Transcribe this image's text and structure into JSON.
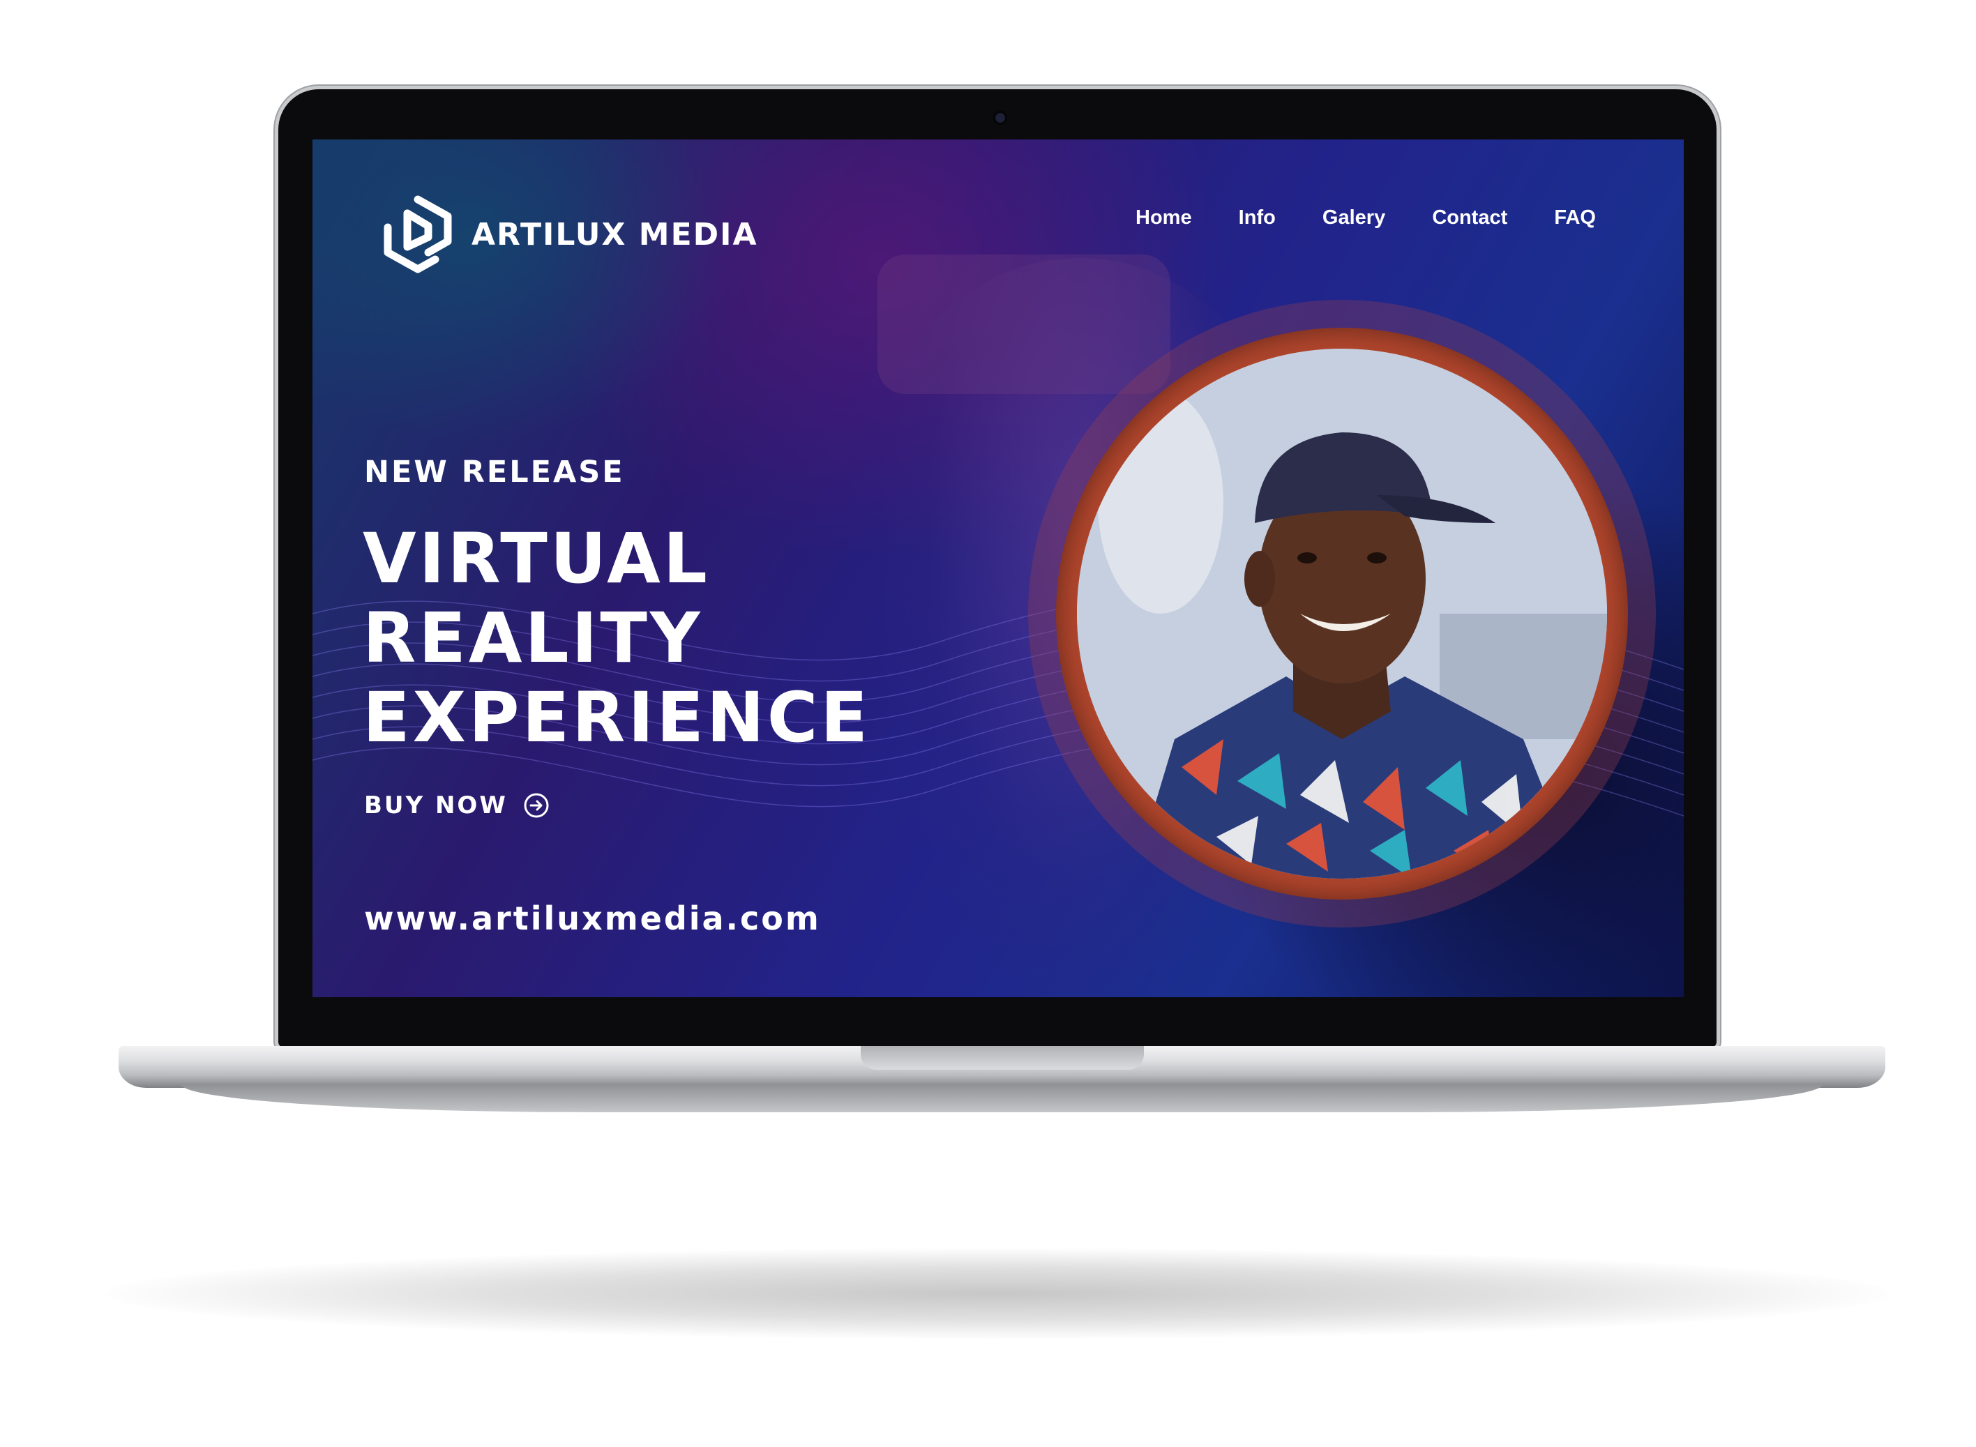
{
  "site": {
    "brand_name": "ARTILUX MEDIA",
    "logo_icon": "artilux-logo-icon"
  },
  "nav": {
    "items": [
      {
        "label": "Home"
      },
      {
        "label": "Info"
      },
      {
        "label": "Galery"
      },
      {
        "label": "Contact"
      },
      {
        "label": "FAQ"
      }
    ]
  },
  "hero": {
    "subtitle": "NEW RELEASE",
    "headline_lines": [
      "VIRTUAL",
      "REALITY",
      "EXPERIENCE"
    ],
    "cta_label": "BUY NOW",
    "cta_icon": "arrow-right-circle-icon",
    "website": "www.artiluxmedia.com"
  },
  "colors": {
    "accent_ring": "#b2462d",
    "background_primary": "#22238a",
    "text": "#ffffff"
  }
}
